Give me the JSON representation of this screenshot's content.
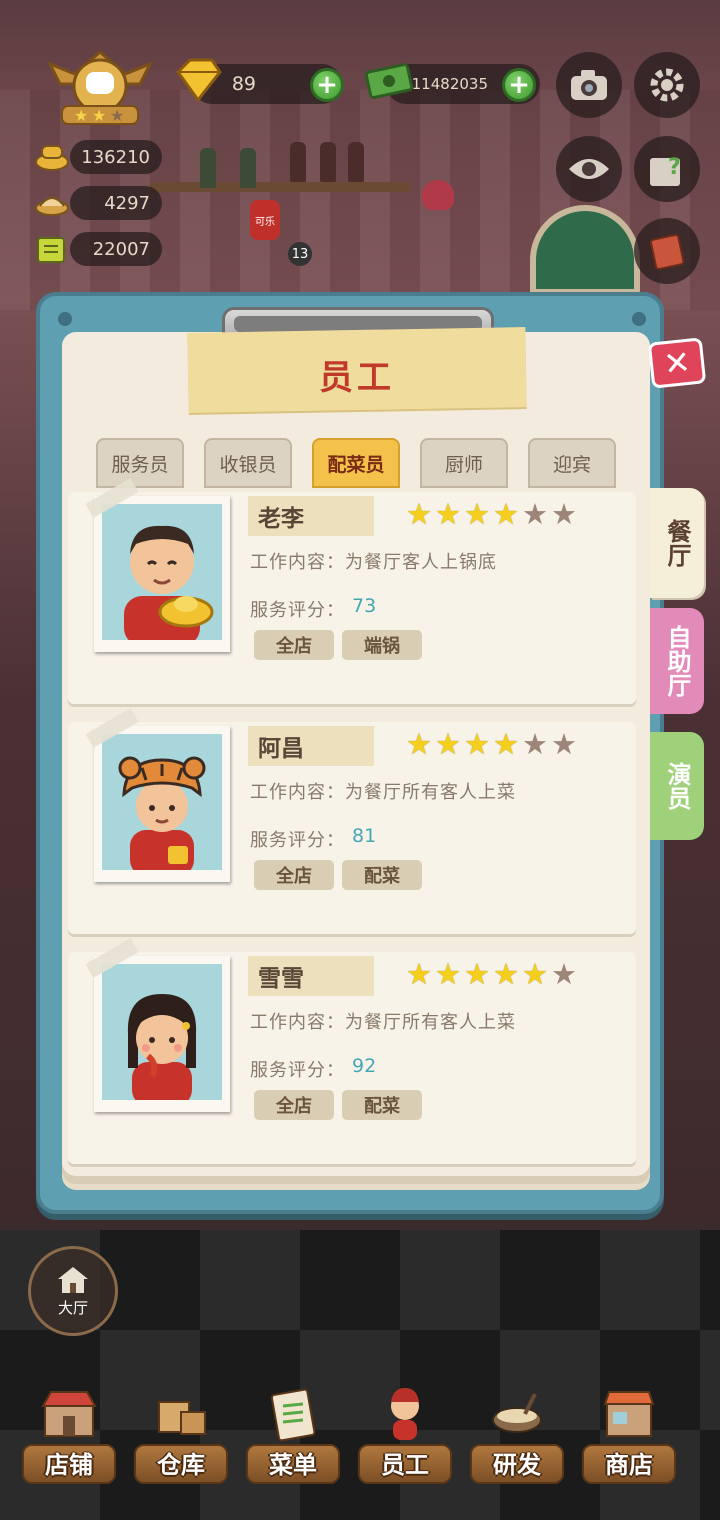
{
  "hud": {
    "diamonds": "89",
    "cash": "11482035",
    "resources": [
      {
        "name": "chef-hat-icon",
        "value": "136210"
      },
      {
        "name": "dish-icon",
        "value": "4297"
      },
      {
        "name": "ticket-icon",
        "value": "22007"
      }
    ],
    "plus": "+",
    "badge_count": "13",
    "cola_label": "可乐"
  },
  "panel": {
    "title": "员工",
    "close": "✕",
    "tabs": [
      {
        "label": "服务员",
        "active": false
      },
      {
        "label": "收银员",
        "active": false
      },
      {
        "label": "配菜员",
        "active": true
      },
      {
        "label": "厨师",
        "active": false
      },
      {
        "label": "迎宾",
        "active": false
      }
    ],
    "side_tabs": [
      {
        "label": "餐厅",
        "color": "#f5eed9"
      },
      {
        "label": "自助厅",
        "color": "#e38bb8"
      },
      {
        "label": "演员",
        "color": "#9fd07a"
      }
    ]
  },
  "staff_card_labels": {
    "job_prefix": "工作内容：",
    "score_prefix": "服务评分："
  },
  "staff": [
    {
      "name": "老李",
      "stars": 4,
      "max_stars": 6,
      "job": "为餐厅客人上锅底",
      "score": "73",
      "tags": [
        "全店",
        "端锅"
      ]
    },
    {
      "name": "阿昌",
      "stars": 4,
      "max_stars": 6,
      "job": "为餐厅所有客人上菜",
      "score": "81",
      "tags": [
        "全店",
        "配菜"
      ]
    },
    {
      "name": "雪雪",
      "stars": 5,
      "max_stars": 6,
      "job": "为餐厅所有客人上菜",
      "score": "92",
      "tags": [
        "全店",
        "配菜"
      ]
    }
  ],
  "hall_button": "大厅",
  "nav": [
    {
      "label": "店铺",
      "icon": "shop-icon"
    },
    {
      "label": "仓库",
      "icon": "warehouse-box-icon"
    },
    {
      "label": "菜单",
      "icon": "menu-clipboard-icon"
    },
    {
      "label": "员工",
      "icon": "staff-icon"
    },
    {
      "label": "研发",
      "icon": "research-pot-icon"
    },
    {
      "label": "商店",
      "icon": "store-icon"
    }
  ],
  "colors": {
    "panel_frame": "#5f9fb2",
    "paper": "#f3ecde",
    "active_tab": "#f4c24a",
    "title_red": "#c0392b",
    "score_teal": "#45a7b5"
  }
}
